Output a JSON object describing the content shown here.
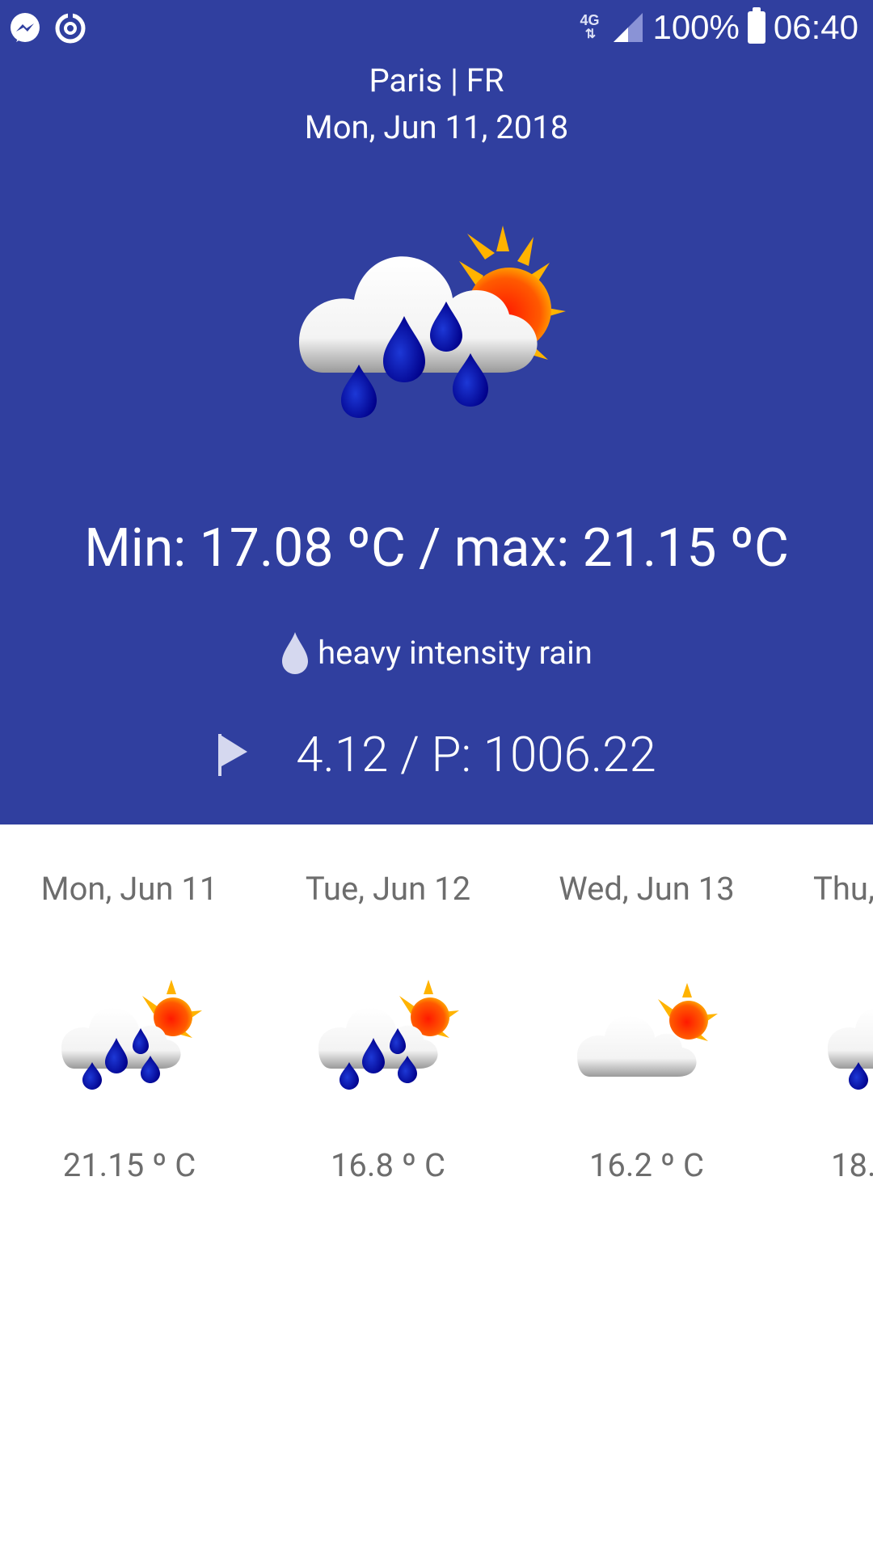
{
  "status_bar": {
    "network": "4G",
    "battery": "100%",
    "time": "06:40",
    "left_icons": [
      "messenger-icon",
      "sync-icon"
    ]
  },
  "location": {
    "city": "Paris | FR",
    "date": "Mon, Jun 11, 2018"
  },
  "current": {
    "icon": "rain-sun-cloud-icon",
    "temps": "Min: 17.08 ºC / max: 21.15 ºC",
    "description": "heavy intensity rain",
    "wind_pressure": "4.12 / P: 1006.22"
  },
  "forecast": [
    {
      "date": "Mon, Jun 11",
      "temp": "21.15 º C",
      "icon": "rain-sun-cloud-icon"
    },
    {
      "date": "Tue, Jun 12",
      "temp": "16.8 º C",
      "icon": "rain-sun-cloud-icon"
    },
    {
      "date": "Wed, Jun 13",
      "temp": "16.2 º C",
      "icon": "cloud-sun-icon"
    },
    {
      "date": "Thu,",
      "temp": "18.",
      "icon": "rain-sun-cloud-icon"
    }
  ],
  "colors": {
    "header_bg": "#303f9f",
    "text_on_header": "#ffffff",
    "forecast_text": "#6d6d6d"
  }
}
